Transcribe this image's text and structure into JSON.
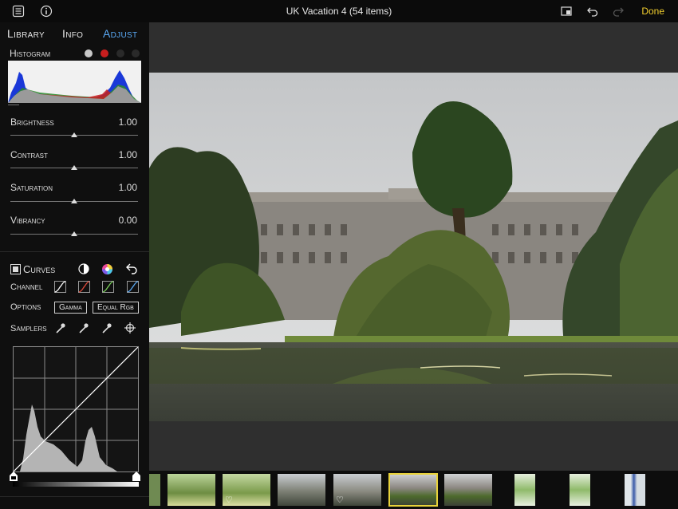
{
  "window": {
    "title": "UK Vacation 4 (54 items)",
    "done_label": "Done"
  },
  "icons": {
    "menu": "list-icon",
    "info": "info-icon",
    "compare": "compare-icon",
    "undo": "undo-icon",
    "redo": "redo-icon"
  },
  "tabs": [
    {
      "label": "Library",
      "active": false
    },
    {
      "label": "Info",
      "active": false
    },
    {
      "label": "Adjust",
      "active": true
    }
  ],
  "histogram": {
    "label": "Histogram",
    "channel_dots": [
      "#c8c8c8",
      "#c81e1e",
      "#2a2a2a",
      "#2a2a2a"
    ]
  },
  "adjustments": [
    {
      "name": "Brightness",
      "value": "1.00",
      "level": 0.5
    },
    {
      "name": "Contrast",
      "value": "1.00",
      "level": 0.5
    },
    {
      "name": "Saturation",
      "value": "1.00",
      "level": 0.5
    },
    {
      "name": "Vibrancy",
      "value": "0.00",
      "level": 0.5
    }
  ],
  "curves": {
    "label": "Curves",
    "channel_label": "Channel",
    "options_label": "Options",
    "gamma_label": "Gamma",
    "equal_rgb_label": "Equal Rgb",
    "samplers_label": "Samplers",
    "channel_colors": [
      "#ffffff",
      "#e04a3a",
      "#7ad05a",
      "#5aa9f5"
    ]
  },
  "filmstrip": {
    "selected_index": 5,
    "favorites": [
      1,
      3
    ]
  },
  "colors": {
    "accent": "#5aa9f5",
    "done": "#f2cf2e",
    "selection": "#e8d23a"
  }
}
